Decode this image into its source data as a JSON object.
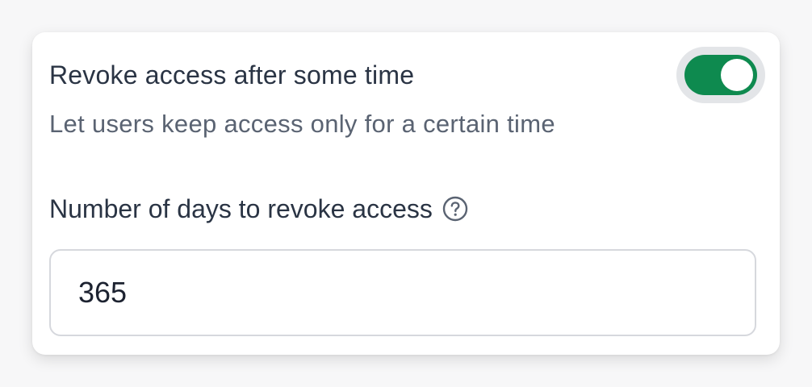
{
  "revoke": {
    "title": "Revoke access after some time",
    "description": "Let users keep access only for a certain time",
    "toggle_on": true,
    "toggle_color": "#0e8a4f"
  },
  "days_field": {
    "label": "Number of days to revoke access",
    "help_icon": "question-circle-icon",
    "value": "365"
  }
}
